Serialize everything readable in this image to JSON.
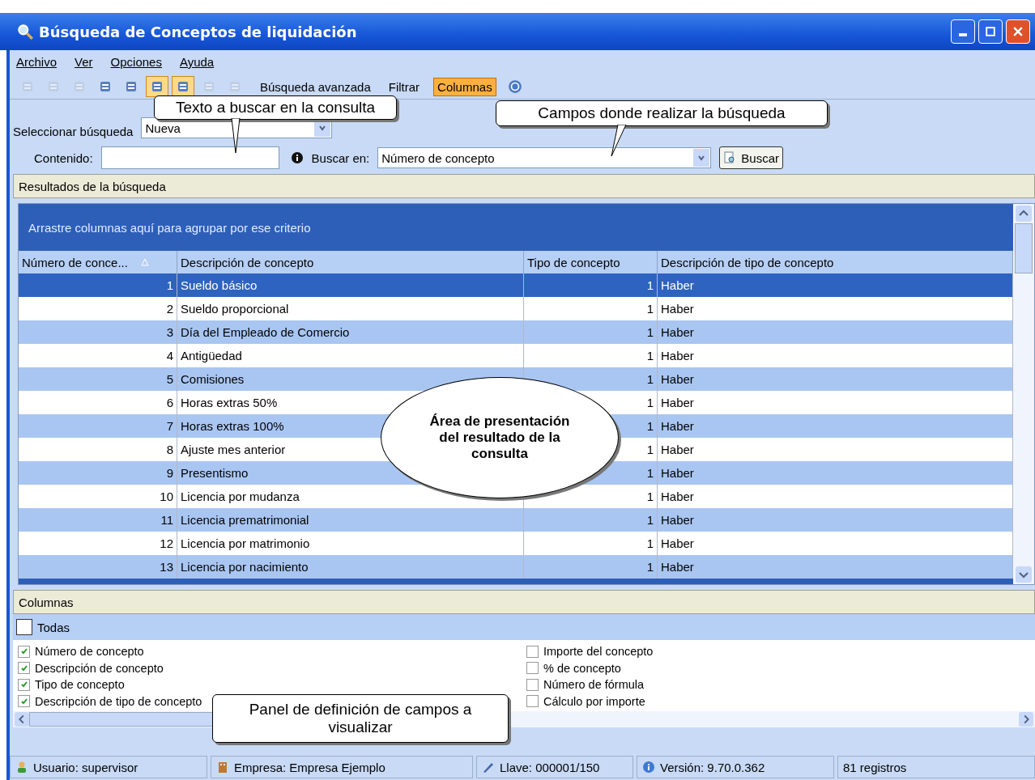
{
  "window": {
    "title": "Búsqueda de Conceptos de liquidación"
  },
  "menu": [
    {
      "label": "Archivo"
    },
    {
      "label": "Ver"
    },
    {
      "label": "Opciones"
    },
    {
      "label": "Ayuda"
    }
  ],
  "toolbar": {
    "icon_buttons": [
      {
        "disabled": true,
        "pressed": false
      },
      {
        "disabled": true,
        "pressed": false
      },
      {
        "disabled": true,
        "pressed": false
      },
      {
        "disabled": false,
        "pressed": false
      },
      {
        "disabled": false,
        "pressed": false
      },
      {
        "disabled": false,
        "pressed": true
      },
      {
        "disabled": false,
        "pressed": true
      },
      {
        "disabled": true,
        "pressed": false
      },
      {
        "disabled": true,
        "pressed": false
      }
    ],
    "text_buttons": [
      {
        "label": "Búsqueda avanzada",
        "pressed": false
      },
      {
        "label": "Filtrar",
        "pressed": false
      },
      {
        "label": "Columnas",
        "pressed": true
      }
    ]
  },
  "search": {
    "select_label": "Seleccionar búsqueda",
    "select_value": "Nueva",
    "content_label": "Contenido:",
    "search_in_label": "Buscar en:",
    "search_in_value": "Número de concepto",
    "button": "Buscar"
  },
  "results": {
    "title": "Resultados de la búsqueda",
    "group_hint": "Arrastre columnas aquí para agrupar por ese criterio",
    "columns": [
      "Número de conce...",
      "Descripción de concepto",
      "Tipo de concepto",
      "Descripción de tipo de concepto"
    ],
    "rows": [
      {
        "number": "1",
        "description": "Sueldo básico",
        "type": "1",
        "type_description": "Haber",
        "selected": true
      },
      {
        "number": "2",
        "description": "Sueldo proporcional",
        "type": "1",
        "type_description": "Haber",
        "selected": false
      },
      {
        "number": "3",
        "description": "Día del Empleado de Comercio",
        "type": "1",
        "type_description": "Haber",
        "selected": false
      },
      {
        "number": "4",
        "description": "Antigüedad",
        "type": "1",
        "type_description": "Haber",
        "selected": false
      },
      {
        "number": "5",
        "description": "Comisiones",
        "type": "1",
        "type_description": "Haber",
        "selected": false
      },
      {
        "number": "6",
        "description": "Horas extras  50%",
        "type": "1",
        "type_description": "Haber",
        "selected": false
      },
      {
        "number": "7",
        "description": "Horas extras 100%",
        "type": "1",
        "type_description": "Haber",
        "selected": false
      },
      {
        "number": "8",
        "description": "Ajuste mes anterior",
        "type": "1",
        "type_description": "Haber",
        "selected": false
      },
      {
        "number": "9",
        "description": "Presentismo",
        "type": "1",
        "type_description": "Haber",
        "selected": false
      },
      {
        "number": "10",
        "description": "Licencia por mudanza",
        "type": "1",
        "type_description": "Haber",
        "selected": false
      },
      {
        "number": "11",
        "description": "Licencia prematrimonial",
        "type": "1",
        "type_description": "Haber",
        "selected": false
      },
      {
        "number": "12",
        "description": "Licencia por matrimonio",
        "type": "1",
        "type_description": "Haber",
        "selected": false
      },
      {
        "number": "13",
        "description": "Licencia por nacimiento",
        "type": "1",
        "type_description": "Haber",
        "selected": false
      }
    ]
  },
  "columns_panel": {
    "title": "Columnas",
    "all": {
      "label": "Todas",
      "checked": false
    },
    "items": [
      {
        "label": "Número de concepto",
        "checked": true
      },
      {
        "label": "Descripción de concepto",
        "checked": true
      },
      {
        "label": "Tipo de concepto",
        "checked": true
      },
      {
        "label": "Descripción de tipo de concepto",
        "checked": true
      },
      {
        "label": "Importe del concepto",
        "checked": false
      },
      {
        "label": "% de concepto",
        "checked": false
      },
      {
        "label": "Número de fórmula",
        "checked": false
      },
      {
        "label": "Cálculo por importe",
        "checked": false
      }
    ]
  },
  "status_bar": [
    "Usuario: supervisor",
    "Empresa: Empresa Ejemplo",
    "Llave: 000001/150",
    "Versión: 9.70.0.362",
    "81 registros"
  ],
  "callouts": [
    {
      "text": "Texto a buscar en la consulta",
      "kind": "rect"
    },
    {
      "text": "Campos donde realizar la búsqueda",
      "kind": "rect"
    },
    {
      "text": "Área de presentación del resultado de la consulta",
      "kind": "ellipse"
    },
    {
      "text": "Panel de definición de campos a visualizar",
      "kind": "rect"
    }
  ]
}
